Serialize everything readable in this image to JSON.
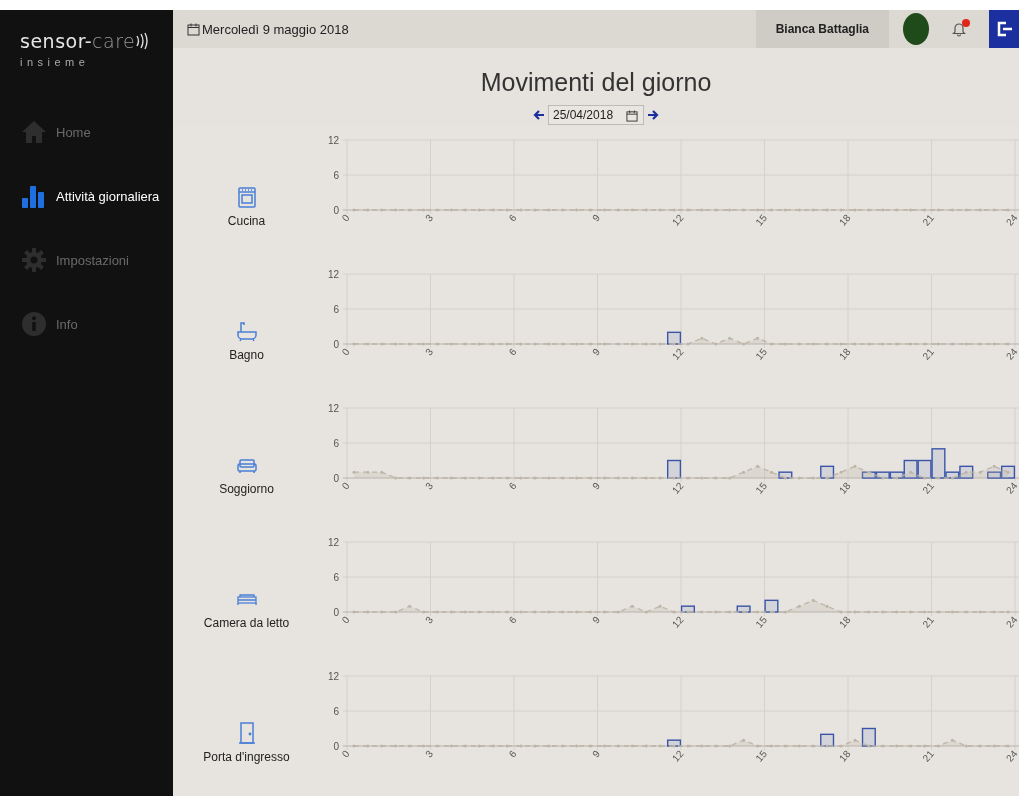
{
  "logo": {
    "word": "sensor-",
    "accent": "care",
    "tagline": "insieme"
  },
  "sidebar": {
    "items": [
      {
        "label": "Home",
        "kind": "home",
        "selected": false
      },
      {
        "label": "Attività giornaliera",
        "kind": "activity",
        "selected": true
      },
      {
        "label": "Impostazioni",
        "kind": "settings",
        "selected": false
      },
      {
        "label": "Info",
        "kind": "info",
        "selected": false
      }
    ]
  },
  "topbar": {
    "date": "Mercoledì 9 maggio 2018",
    "user": "Bianca Battaglia",
    "notifications_unread": true
  },
  "header": {
    "title": "Movimenti del giorno",
    "date_value": "25/04/2018"
  },
  "rooms": [
    {
      "name": "Cucina",
      "kind": "kitchen",
      "chart_data": {
        "type": "bar",
        "grid": true,
        "x": [
          0.25,
          0.75,
          1.25,
          1.75,
          2.25,
          2.75,
          3.25,
          3.75,
          4.25,
          4.75,
          5.25,
          5.75,
          6.25,
          6.75,
          7.25,
          7.75,
          8.25,
          8.75,
          9.25,
          9.75,
          10.25,
          10.75,
          11.25,
          11.75,
          12.25,
          12.75,
          13.25,
          13.75,
          14.25,
          14.75,
          15.25,
          15.75,
          16.25,
          16.75,
          17.25,
          17.75,
          18.25,
          18.75,
          19.25,
          19.75,
          20.25,
          20.75,
          21.25,
          21.75,
          22.25,
          22.75,
          23.25,
          23.75
        ],
        "xlim": [
          0,
          24
        ],
        "ylim": [
          0,
          12
        ],
        "xticks": [
          0,
          3,
          6,
          9,
          12,
          15,
          18,
          21,
          24
        ],
        "yticks": [
          0,
          6,
          12
        ],
        "series": [
          {
            "color": "#3a55a8",
            "values": [
              0,
              0,
              0,
              0,
              0,
              0,
              0,
              0,
              0,
              0,
              0,
              0,
              0,
              0,
              0,
              0,
              0,
              0,
              0,
              0,
              0,
              0,
              0,
              0,
              0,
              0,
              0,
              0,
              0,
              0,
              0,
              0,
              0,
              0,
              0,
              0,
              0,
              0,
              0,
              0,
              0,
              0,
              0,
              0,
              0,
              0,
              0,
              0
            ]
          },
          {
            "type": "line",
            "line_style": "dashed",
            "color": "#bdb5a8",
            "values": [
              0,
              0,
              0,
              0,
              0,
              0,
              0,
              0,
              0,
              0,
              0,
              0,
              0,
              0,
              0,
              0,
              0,
              0,
              0,
              0,
              0,
              0,
              0,
              0,
              0,
              0,
              0,
              0,
              0,
              0,
              0,
              0,
              0,
              0,
              0,
              0,
              0,
              0,
              0,
              0,
              0,
              0,
              0,
              0,
              0,
              0,
              0,
              0
            ]
          }
        ]
      }
    },
    {
      "name": "Bagno",
      "kind": "bathroom",
      "chart_data": {
        "type": "bar",
        "grid": true,
        "x": [
          0.25,
          0.75,
          1.25,
          1.75,
          2.25,
          2.75,
          3.25,
          3.75,
          4.25,
          4.75,
          5.25,
          5.75,
          6.25,
          6.75,
          7.25,
          7.75,
          8.25,
          8.75,
          9.25,
          9.75,
          10.25,
          10.75,
          11.25,
          11.75,
          12.25,
          12.75,
          13.25,
          13.75,
          14.25,
          14.75,
          15.25,
          15.75,
          16.25,
          16.75,
          17.25,
          17.75,
          18.25,
          18.75,
          19.25,
          19.75,
          20.25,
          20.75,
          21.25,
          21.75,
          22.25,
          22.75,
          23.25,
          23.75
        ],
        "xlim": [
          0,
          24
        ],
        "ylim": [
          0,
          12
        ],
        "xticks": [
          0,
          3,
          6,
          9,
          12,
          15,
          18,
          21,
          24
        ],
        "yticks": [
          0,
          6,
          12
        ],
        "series": [
          {
            "color": "#3a55a8",
            "values": [
              0,
              0,
              0,
              0,
              0,
              0,
              0,
              0,
              0,
              0,
              0,
              0,
              0,
              0,
              0,
              0,
              0,
              0,
              0,
              0,
              0,
              0,
              0,
              2,
              0,
              0,
              0,
              0,
              0,
              0,
              0,
              0,
              0,
              0,
              0,
              0,
              0,
              0,
              0,
              0,
              0,
              0,
              0,
              0,
              0,
              0,
              0,
              0
            ]
          },
          {
            "type": "line",
            "line_style": "dashed",
            "color": "#bdb5a8",
            "values": [
              0,
              0,
              0,
              0,
              0,
              0,
              0,
              0,
              0,
              0,
              0,
              0,
              0,
              0,
              0,
              0,
              0,
              0,
              0,
              0,
              0,
              0,
              0,
              0,
              0,
              1,
              0,
              1,
              0,
              1,
              0,
              0,
              0,
              0,
              0,
              0,
              0,
              0,
              0,
              0,
              0,
              0,
              0,
              0,
              0,
              0,
              0,
              0
            ]
          }
        ]
      }
    },
    {
      "name": "Soggiorno",
      "kind": "living",
      "chart_data": {
        "type": "bar",
        "grid": true,
        "x": [
          0.25,
          0.75,
          1.25,
          1.75,
          2.25,
          2.75,
          3.25,
          3.75,
          4.25,
          4.75,
          5.25,
          5.75,
          6.25,
          6.75,
          7.25,
          7.75,
          8.25,
          8.75,
          9.25,
          9.75,
          10.25,
          10.75,
          11.25,
          11.75,
          12.25,
          12.75,
          13.25,
          13.75,
          14.25,
          14.75,
          15.25,
          15.75,
          16.25,
          16.75,
          17.25,
          17.75,
          18.25,
          18.75,
          19.25,
          19.75,
          20.25,
          20.75,
          21.25,
          21.75,
          22.25,
          22.75,
          23.25,
          23.75
        ],
        "xlim": [
          0,
          24
        ],
        "ylim": [
          0,
          12
        ],
        "xticks": [
          0,
          3,
          6,
          9,
          12,
          15,
          18,
          21,
          24
        ],
        "yticks": [
          0,
          6,
          12
        ],
        "series": [
          {
            "color": "#3a55a8",
            "values": [
              0,
              0,
              0,
              0,
              0,
              0,
              0,
              0,
              0,
              0,
              0,
              0,
              0,
              0,
              0,
              0,
              0,
              0,
              0,
              0,
              0,
              0,
              0,
              3,
              0,
              0,
              0,
              0,
              0,
              0,
              0,
              1,
              0,
              0,
              2,
              0,
              0,
              1,
              1,
              1,
              3,
              3,
              5,
              1,
              2,
              0,
              1,
              2
            ]
          },
          {
            "type": "line",
            "line_style": "dashed",
            "color": "#bdb5a8",
            "values": [
              1,
              1,
              1,
              0,
              0,
              0,
              0,
              0,
              0,
              0,
              0,
              0,
              0,
              0,
              0,
              0,
              0,
              0,
              0,
              0,
              0,
              0,
              0,
              0,
              0,
              0,
              0,
              0,
              1,
              2,
              1,
              0,
              0,
              0,
              0,
              1,
              2,
              1,
              0,
              0,
              1,
              0,
              0,
              0,
              1,
              1,
              2,
              1
            ]
          }
        ]
      }
    },
    {
      "name": "Camera da letto",
      "kind": "bedroom",
      "chart_data": {
        "type": "bar",
        "grid": true,
        "x": [
          0.25,
          0.75,
          1.25,
          1.75,
          2.25,
          2.75,
          3.25,
          3.75,
          4.25,
          4.75,
          5.25,
          5.75,
          6.25,
          6.75,
          7.25,
          7.75,
          8.25,
          8.75,
          9.25,
          9.75,
          10.25,
          10.75,
          11.25,
          11.75,
          12.25,
          12.75,
          13.25,
          13.75,
          14.25,
          14.75,
          15.25,
          15.75,
          16.25,
          16.75,
          17.25,
          17.75,
          18.25,
          18.75,
          19.25,
          19.75,
          20.25,
          20.75,
          21.25,
          21.75,
          22.25,
          22.75,
          23.25,
          23.75
        ],
        "xlim": [
          0,
          24
        ],
        "ylim": [
          0,
          12
        ],
        "xticks": [
          0,
          3,
          6,
          9,
          12,
          15,
          18,
          21,
          24
        ],
        "yticks": [
          0,
          6,
          12
        ],
        "series": [
          {
            "color": "#3a55a8",
            "values": [
              0,
              0,
              0,
              0,
              0,
              0,
              0,
              0,
              0,
              0,
              0,
              0,
              0,
              0,
              0,
              0,
              0,
              0,
              0,
              0,
              0,
              0,
              0,
              0,
              1,
              0,
              0,
              0,
              1,
              0,
              2,
              0,
              0,
              0,
              0,
              0,
              0,
              0,
              0,
              0,
              0,
              0,
              0,
              0,
              0,
              0,
              0,
              0
            ]
          },
          {
            "type": "line",
            "line_style": "dashed",
            "color": "#bdb5a8",
            "values": [
              0,
              0,
              0,
              0,
              1,
              0,
              0,
              0,
              0,
              0,
              0,
              0,
              0,
              0,
              0,
              0,
              0,
              0,
              0,
              0,
              1,
              0,
              1,
              0,
              0,
              0,
              0,
              0,
              0,
              0,
              0,
              0,
              1,
              2,
              1,
              0,
              0,
              0,
              0,
              0,
              0,
              0,
              0,
              0,
              0,
              0,
              0,
              0
            ]
          }
        ]
      }
    },
    {
      "name": "Porta d'ingresso",
      "kind": "entrance",
      "chart_data": {
        "type": "bar",
        "grid": true,
        "x": [
          0.25,
          0.75,
          1.25,
          1.75,
          2.25,
          2.75,
          3.25,
          3.75,
          4.25,
          4.75,
          5.25,
          5.75,
          6.25,
          6.75,
          7.25,
          7.75,
          8.25,
          8.75,
          9.25,
          9.75,
          10.25,
          10.75,
          11.25,
          11.75,
          12.25,
          12.75,
          13.25,
          13.75,
          14.25,
          14.75,
          15.25,
          15.75,
          16.25,
          16.75,
          17.25,
          17.75,
          18.25,
          18.75,
          19.25,
          19.75,
          20.25,
          20.75,
          21.25,
          21.75,
          22.25,
          22.75,
          23.25,
          23.75
        ],
        "xlim": [
          0,
          24
        ],
        "ylim": [
          0,
          12
        ],
        "xticks": [
          0,
          3,
          6,
          9,
          12,
          15,
          18,
          21,
          24
        ],
        "yticks": [
          0,
          6,
          12
        ],
        "series": [
          {
            "color": "#3a55a8",
            "values": [
              0,
              0,
              0,
              0,
              0,
              0,
              0,
              0,
              0,
              0,
              0,
              0,
              0,
              0,
              0,
              0,
              0,
              0,
              0,
              0,
              0,
              0,
              0,
              1,
              0,
              0,
              0,
              0,
              0,
              0,
              0,
              0,
              0,
              0,
              2,
              0,
              0,
              3,
              0,
              0,
              0,
              0,
              0,
              0,
              0,
              0,
              0,
              0
            ]
          },
          {
            "type": "line",
            "line_style": "dashed",
            "color": "#bdb5a8",
            "values": [
              0,
              0,
              0,
              0,
              0,
              0,
              0,
              0,
              0,
              0,
              0,
              0,
              0,
              0,
              0,
              0,
              0,
              0,
              0,
              0,
              0,
              0,
              0,
              0,
              0,
              0,
              0,
              0,
              1,
              0,
              0,
              0,
              0,
              0,
              0,
              0,
              1,
              0,
              0,
              0,
              0,
              0,
              0,
              1,
              0,
              0,
              0,
              0
            ]
          }
        ]
      }
    }
  ]
}
